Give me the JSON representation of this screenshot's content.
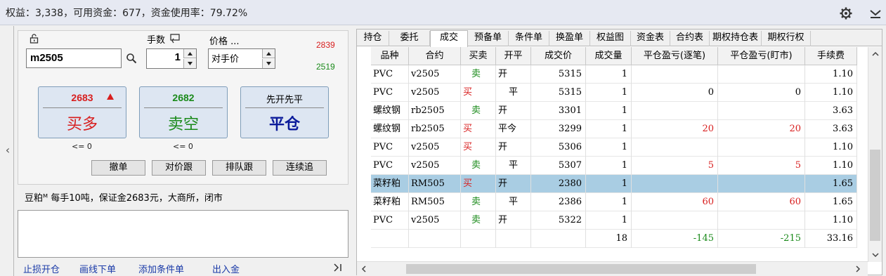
{
  "status": {
    "text": "权益：3,338，可用资金：677，资金使用率：79.72%"
  },
  "icons": {
    "settings": "gear-icon",
    "minimize": "chevron-down-icon",
    "lock": "unlock-icon",
    "search": "search-icon"
  },
  "order": {
    "contract": "m2505",
    "qty_label": "手数",
    "qty": "1",
    "price_label": "价格 ...",
    "price_mode": "对手价",
    "high_price": "2839",
    "low_price": "2519",
    "buy": {
      "price": "2683",
      "label": "买多",
      "limit": "<= 0"
    },
    "sell": {
      "price": "2682",
      "label": "卖空",
      "limit": "<= 0"
    },
    "close": {
      "mode": "先开先平",
      "label": "平仓"
    },
    "buttons": [
      "撤单",
      "对价跟",
      "排队跟",
      "连续追"
    ],
    "info": "豆粕ᴹ  每手10吨，保证金2683元，大商所，闭市",
    "links": [
      "止损开仓",
      "画线下单",
      "添加条件单",
      "出入金"
    ]
  },
  "tabs": [
    "持仓",
    "委托",
    "成交",
    "预备单",
    "条件单",
    "换盈单",
    "权益图",
    "资金表",
    "合约表",
    "期权持仓表",
    "期权行权"
  ],
  "active_tab": "成交",
  "table": {
    "columns": [
      "品种",
      "合约",
      "买卖",
      "开平",
      "成交价",
      "成交量",
      "平仓盈亏(逐笔)",
      "平仓盈亏(盯市)",
      "手续费"
    ],
    "rows": [
      {
        "name": "PVC",
        "contract": "v2505",
        "side": "卖",
        "oc": "开",
        "price": "5315",
        "vol": "1",
        "pnl1": "",
        "pnl2": "",
        "fee": "1.10"
      },
      {
        "name": "PVC",
        "contract": "v2505",
        "side": "买",
        "oc": "平",
        "price": "5315",
        "vol": "1",
        "pnl1": "0",
        "pnl2": "0",
        "fee": "1.10"
      },
      {
        "name": "螺纹钢",
        "contract": "rb2505",
        "side": "卖",
        "oc": "开",
        "price": "3301",
        "vol": "1",
        "pnl1": "",
        "pnl2": "",
        "fee": "3.63"
      },
      {
        "name": "螺纹钢",
        "contract": "rb2505",
        "side": "买",
        "oc": "平今",
        "price": "3299",
        "vol": "1",
        "pnl1": "20",
        "pnl2": "20",
        "fee": "3.63"
      },
      {
        "name": "PVC",
        "contract": "v2505",
        "side": "买",
        "oc": "开",
        "price": "5306",
        "vol": "1",
        "pnl1": "",
        "pnl2": "",
        "fee": "1.10"
      },
      {
        "name": "PVC",
        "contract": "v2505",
        "side": "卖",
        "oc": "平",
        "price": "5307",
        "vol": "1",
        "pnl1": "5",
        "pnl2": "5",
        "fee": "1.10"
      },
      {
        "name": "菜籽粕",
        "contract": "RM505",
        "side": "买",
        "oc": "开",
        "price": "2380",
        "vol": "1",
        "pnl1": "",
        "pnl2": "",
        "fee": "1.65"
      },
      {
        "name": "菜籽粕",
        "contract": "RM505",
        "side": "卖",
        "oc": "平",
        "price": "2386",
        "vol": "1",
        "pnl1": "60",
        "pnl2": "60",
        "fee": "1.65"
      },
      {
        "name": "PVC",
        "contract": "v2505",
        "side": "卖",
        "oc": "开",
        "price": "5322",
        "vol": "1",
        "pnl1": "",
        "pnl2": "",
        "fee": "1.10"
      }
    ],
    "selected_row": 6,
    "totals": {
      "vol": "18",
      "pnl1": "-145",
      "pnl2": "-215",
      "fee": "33.16"
    }
  },
  "colors": {
    "buy": "#d81e1e",
    "sell": "#1a8a1a",
    "selected": "#a9cde3",
    "close_label": "#0a1a9a"
  }
}
